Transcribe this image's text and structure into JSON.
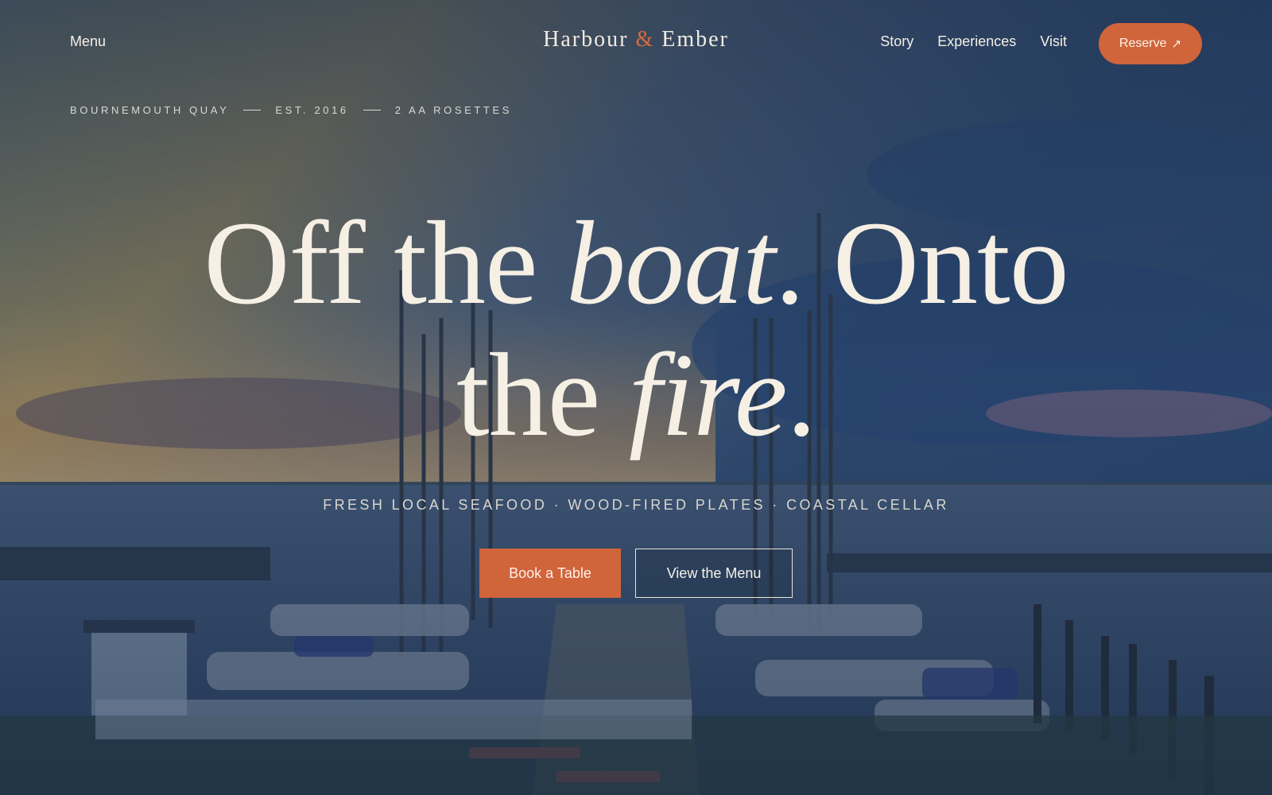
{
  "nav": {
    "menu_label": "Menu",
    "brand": {
      "part1": "Harbour",
      "amp": "&",
      "part2": "Ember"
    },
    "links": [
      "Story",
      "Experiences",
      "Visit"
    ],
    "reserve_label": "Reserve",
    "reserve_icon": "arrow-up-right-icon"
  },
  "meta": {
    "location": "BOURNEMOUTH QUAY",
    "established": "EST. 2016",
    "award": "2 AA ROSETTES"
  },
  "hero": {
    "headline": {
      "w1": "Off the ",
      "w2": "boat",
      "w3": ". Onto",
      "w4": "the ",
      "w5": "fire",
      "w6": "."
    },
    "tagline": "FRESH LOCAL SEAFOOD · WOOD-FIRED PLATES · COASTAL CELLAR",
    "primary_cta": "Book a Table",
    "secondary_cta": "View the Menu"
  },
  "colors": {
    "accent": "#d0643b",
    "overlay": "#1f3551",
    "text": "#f4efe6"
  }
}
